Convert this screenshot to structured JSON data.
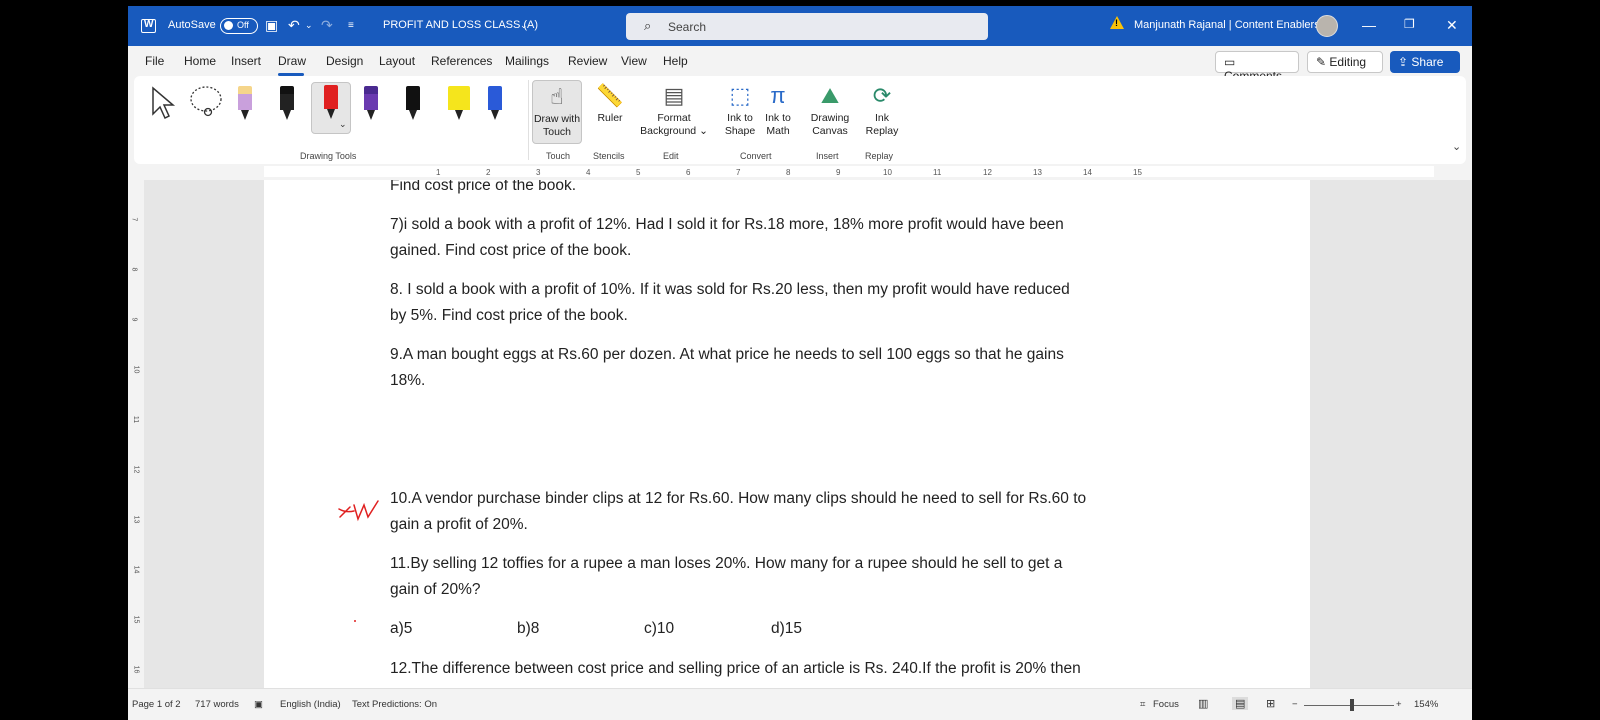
{
  "titlebar": {
    "autosave_label": "AutoSave",
    "autosave_state": "Off",
    "document_title": "PROFIT AND LOSS CLASS (A)",
    "search_placeholder": "Search",
    "user": "Manjunath Rajanal | Content Enablers"
  },
  "menu": {
    "tabs": [
      "File",
      "Home",
      "Insert",
      "Draw",
      "Design",
      "Layout",
      "References",
      "Mailings",
      "Review",
      "View",
      "Help"
    ],
    "active_tab": "Draw",
    "comments_label": "Comments",
    "editing_label": "Editing",
    "share_label": "Share"
  },
  "ribbon": {
    "groups": {
      "drawing_tools": "Drawing Tools",
      "touch": "Touch",
      "stencils": "Stencils",
      "edit": "Edit",
      "convert": "Convert",
      "insert": "Insert",
      "replay": "Replay"
    },
    "buttons": {
      "draw_with_touch_1": "Draw with",
      "draw_with_touch_2": "Touch",
      "ruler": "Ruler",
      "format_bg_1": "Format",
      "format_bg_2": "Background",
      "ink_to_shape_1": "Ink to",
      "ink_to_shape_2": "Shape",
      "ink_to_math_1": "Ink to",
      "ink_to_math_2": "Math",
      "drawing_canvas_1": "Drawing",
      "drawing_canvas_2": "Canvas",
      "ink_replay_1": "Ink",
      "ink_replay_2": "Replay"
    },
    "pens": [
      {
        "color": "#c9a0dc",
        "cap": "#f5d58a"
      },
      {
        "color": "#222222",
        "cap": "#111111"
      },
      {
        "color": "#e02020",
        "cap": "#e02020"
      },
      {
        "color": "#6a3ab0",
        "cap": "#4a2a90"
      },
      {
        "color": "#111111",
        "cap": "#111111"
      },
      {
        "color": "#f5e51c",
        "cap": "#f5e51c"
      },
      {
        "color": "#2a5ad8",
        "cap": "#2a5ad8"
      }
    ]
  },
  "ruler": {
    "h_ticks": [
      "1",
      "2",
      "3",
      "4",
      "5",
      "6",
      "7",
      "8",
      "9",
      "10",
      "11",
      "12",
      "13",
      "14",
      "15"
    ],
    "v_ticks": [
      "7",
      "8",
      "9",
      "10",
      "11",
      "12",
      "13",
      "14",
      "15",
      "16"
    ]
  },
  "document": {
    "partial_line": "Find cost price of the book.",
    "q7_line1": "7)i sold a book with a profit of 12%. Had I sold it for Rs.18 more, 18% more profit would have been",
    "q7_line2": "gained. Find cost price of the book.",
    "q8_line1": "8. I sold a book with a profit of 10%. If it was sold for Rs.20 less, then my profit would have reduced",
    "q8_line2": "by 5%. Find cost price of the book.",
    "q9_line1": "9.A man bought eggs at Rs.60 per dozen. At what price he needs to sell 100 eggs so that he gains",
    "q9_line2": "18%.",
    "q10_line1": "10.A vendor purchase binder clips at 12 for Rs.60. How many clips should he need to sell for Rs.60 to",
    "q10_line2": "gain a profit of 20%.",
    "q11_line1": "11.By selling 12 toffies for a rupee a man loses 20%. How many for a rupee should he sell to get a",
    "q11_line2": "gain of 20%?",
    "options": [
      "a)5",
      "b)8",
      "c)10",
      "d)15"
    ],
    "q12_line1": "12.The difference between cost price and selling price of an article is Rs. 240.If the profit is 20% then"
  },
  "status": {
    "page": "Page 1 of 2",
    "words": "717 words",
    "language": "English (India)",
    "predictions": "Text Predictions: On",
    "focus": "Focus",
    "zoom": "154%"
  },
  "colors": {
    "titlebar": "#185abd",
    "ink_annotation": "#e02020"
  }
}
